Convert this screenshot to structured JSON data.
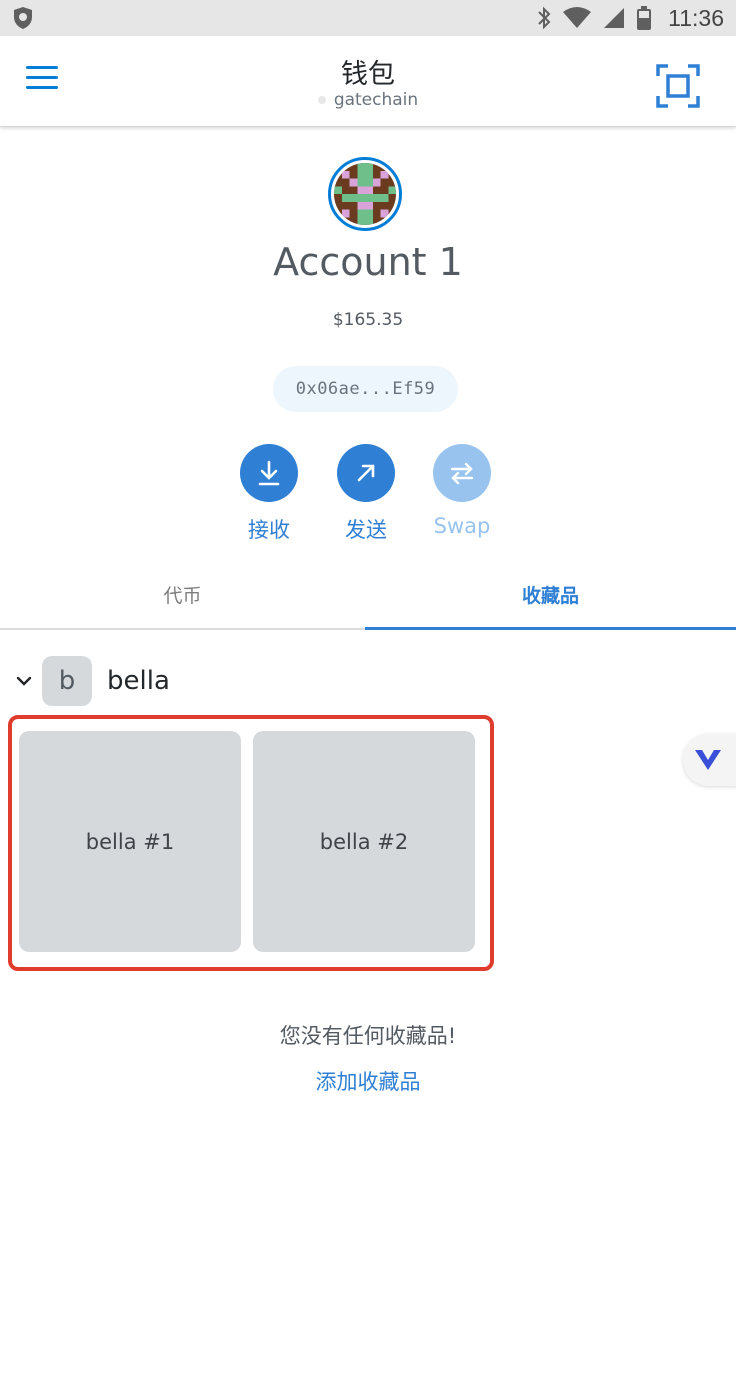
{
  "status_bar": {
    "time": "11:36"
  },
  "header": {
    "title": "钱包",
    "network": "gatechain"
  },
  "account": {
    "name": "Account 1",
    "balance": "$165.35",
    "address": "0x06ae...Ef59"
  },
  "actions": [
    {
      "label": "接收",
      "icon": "download-icon",
      "enabled": true
    },
    {
      "label": "发送",
      "icon": "arrow-up-right-icon",
      "enabled": true
    },
    {
      "label": "Swap",
      "icon": "swap-icon",
      "enabled": false
    }
  ],
  "tabs": {
    "tokens": "代币",
    "collectibles": "收藏品",
    "active": "collectibles"
  },
  "collection": {
    "icon_letter": "b",
    "name": "bella",
    "items": [
      "bella #1",
      "bella #2"
    ]
  },
  "empty_state": {
    "message": "您没有任何收藏品!",
    "add_link": "添加收藏品"
  },
  "colors": {
    "accent": "#2f7fd5",
    "highlight_border": "#e03c2d",
    "card_bg": "#d6d9dc"
  }
}
